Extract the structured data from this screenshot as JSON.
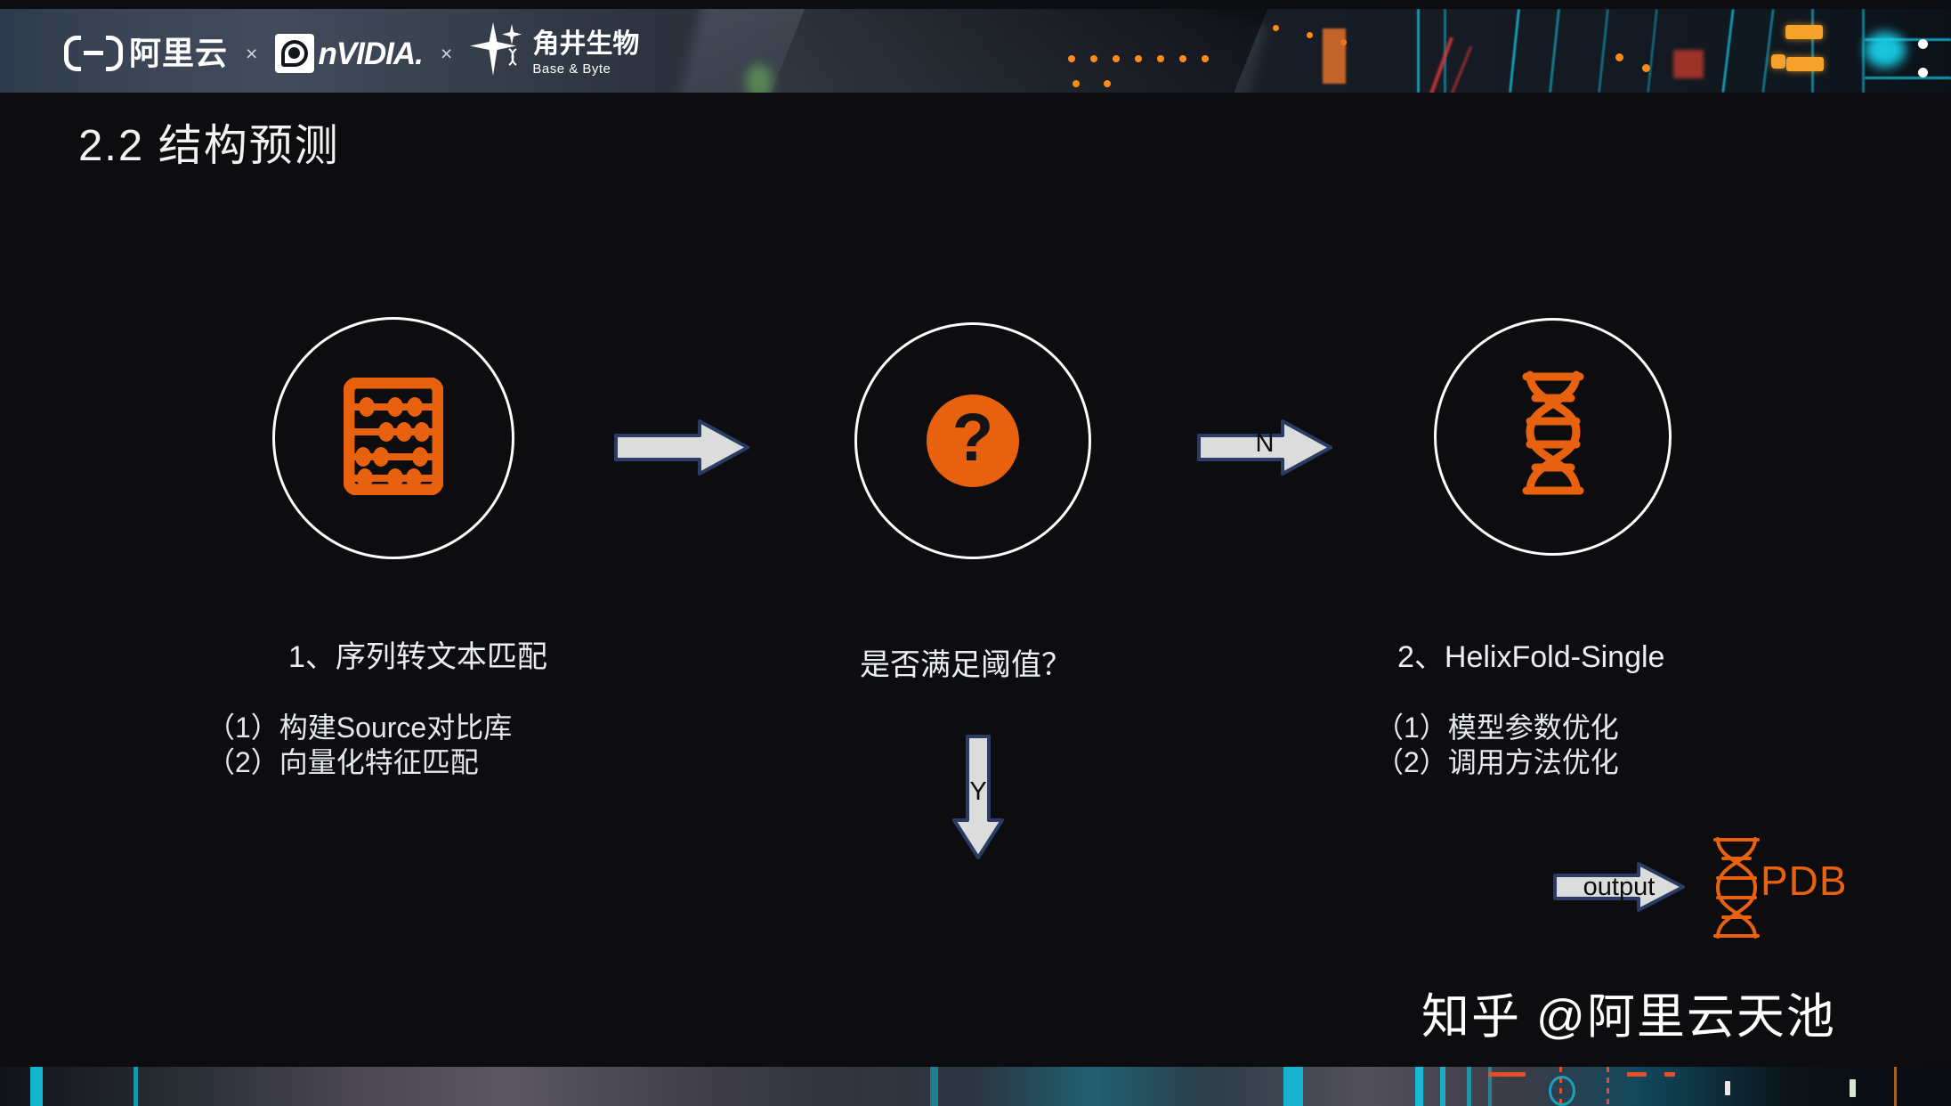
{
  "slide": {
    "title": "2.2 结构预测",
    "watermark": "知乎 @阿里云天池"
  },
  "banner": {
    "logos": [
      {
        "name": "alibaba-cloud",
        "text": "阿里云"
      },
      {
        "name": "nvidia",
        "text": "nVIDIA."
      },
      {
        "name": "base-and-byte",
        "text_cn": "角井生物",
        "text_en": "Base & Byte"
      }
    ],
    "separator": "×"
  },
  "flow": {
    "nodes": [
      {
        "id": "node-sequence-match",
        "icon": "abacus-icon",
        "icon_color": "#e8610f",
        "caption": "1、序列转文本匹配",
        "bullets": [
          "（1）构建Source对比库",
          "（2）向量化特征匹配"
        ]
      },
      {
        "id": "node-threshold-decision",
        "icon": "question-mark-icon",
        "icon_color": "#e8610f",
        "caption": "是否满足阈值？",
        "bullets": []
      },
      {
        "id": "node-helixfold-single",
        "icon": "dna-helix-icon",
        "icon_color": "#e8610f",
        "caption": "2、HelixFold-Single",
        "bullets": [
          "（1）模型参数优化",
          "（2）调用方法优化"
        ]
      }
    ],
    "arrows": [
      {
        "id": "arrow-match-to-decision",
        "label": "",
        "direction": "right"
      },
      {
        "id": "arrow-decision-no",
        "label": "N",
        "direction": "right"
      },
      {
        "id": "arrow-decision-yes",
        "label": "Y",
        "direction": "down"
      },
      {
        "id": "arrow-output",
        "label": "output",
        "direction": "right"
      }
    ],
    "output": {
      "icon": "dna-helix-icon",
      "label": "PDB",
      "label_color": "#e8610f"
    }
  },
  "colors": {
    "background": "#0d0d0f",
    "accent_orange": "#e8610f",
    "text_primary": "#f2f2f2",
    "arrow_fill": "#dcdcdc",
    "arrow_stroke": "#2a3c63",
    "banner_cyan": "#17c3e0"
  }
}
